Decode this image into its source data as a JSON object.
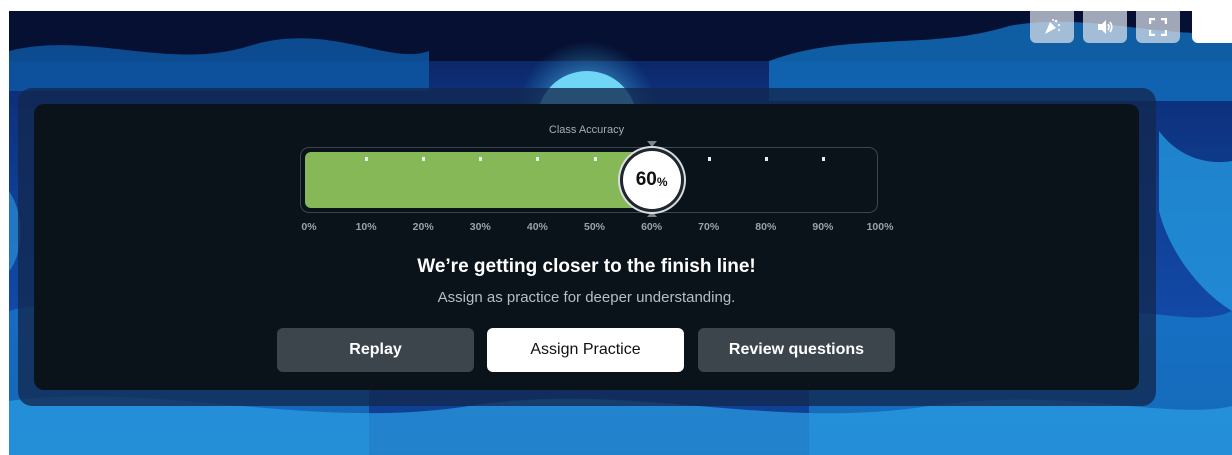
{
  "top_controls": {
    "buttons": [
      {
        "name": "confetti-icon"
      },
      {
        "name": "volume-icon"
      },
      {
        "name": "fullscreen-icon"
      }
    ]
  },
  "results": {
    "accuracy_label": "Class Accuracy",
    "accuracy_value": 60,
    "accuracy_number": "60",
    "accuracy_unit": "%",
    "scale_labels": [
      "0%",
      "10%",
      "20%",
      "30%",
      "40%",
      "50%",
      "60%",
      "70%",
      "80%",
      "90%",
      "100%"
    ],
    "headline": "We’re getting closer to the finish line!",
    "subline": "Assign as practice for deeper understanding."
  },
  "actions": {
    "replay": "Replay",
    "assign_practice": "Assign Practice",
    "review_questions": "Review questions"
  },
  "colors": {
    "accuracy_fill": "#86b857",
    "panel_bg": "#091319",
    "dark_button": "#3d454c",
    "light_button": "#ffffff"
  }
}
